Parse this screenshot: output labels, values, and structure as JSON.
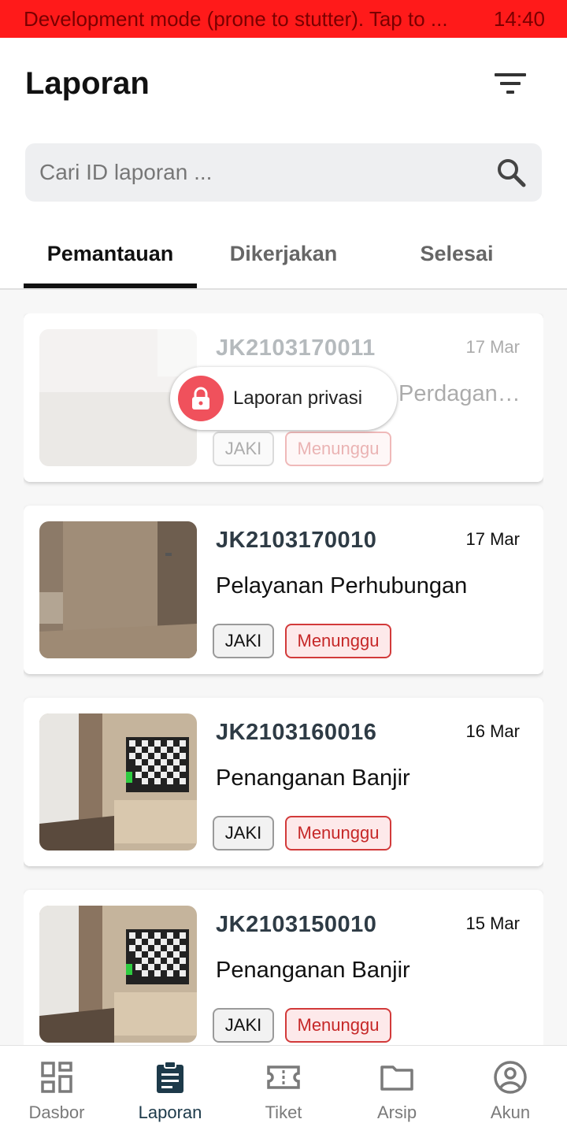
{
  "status_bar": {
    "message": "Development mode (prone to stutter). Tap to ...",
    "time": "14:40"
  },
  "header": {
    "title": "Laporan"
  },
  "search": {
    "placeholder": "Cari ID laporan ..."
  },
  "tabs": [
    {
      "label": "Pemantauan",
      "active": true
    },
    {
      "label": "Dikerjakan",
      "active": false
    },
    {
      "label": "Selesai",
      "active": false
    }
  ],
  "privacy_label": "Laporan privasi",
  "reports": [
    {
      "id": "JK2103170011",
      "date": "17 Mar",
      "category": "Perdagangan",
      "source": "JAKI",
      "status": "Menunggu",
      "private": true
    },
    {
      "id": "JK2103170010",
      "date": "17 Mar",
      "category": "Pelayanan Perhubungan",
      "source": "JAKI",
      "status": "Menunggu",
      "private": false
    },
    {
      "id": "JK2103160016",
      "date": "16 Mar",
      "category": "Penanganan Banjir",
      "source": "JAKI",
      "status": "Menunggu",
      "private": false
    },
    {
      "id": "JK2103150010",
      "date": "15 Mar",
      "category": "Penanganan Banjir",
      "source": "JAKI",
      "status": "Menunggu",
      "private": false
    }
  ],
  "bottom_nav": [
    {
      "label": "Dasbor",
      "icon": "dashboard-icon",
      "active": false
    },
    {
      "label": "Laporan",
      "icon": "clipboard-icon",
      "active": true
    },
    {
      "label": "Tiket",
      "icon": "ticket-icon",
      "active": false
    },
    {
      "label": "Arsip",
      "icon": "folder-icon",
      "active": false
    },
    {
      "label": "Akun",
      "icon": "account-icon",
      "active": false
    }
  ],
  "colors": {
    "status_bar": "#ff1a1a",
    "accent_dark": "#1d3a4a",
    "status_red": "#c62828",
    "lock_red": "#f0515c"
  }
}
